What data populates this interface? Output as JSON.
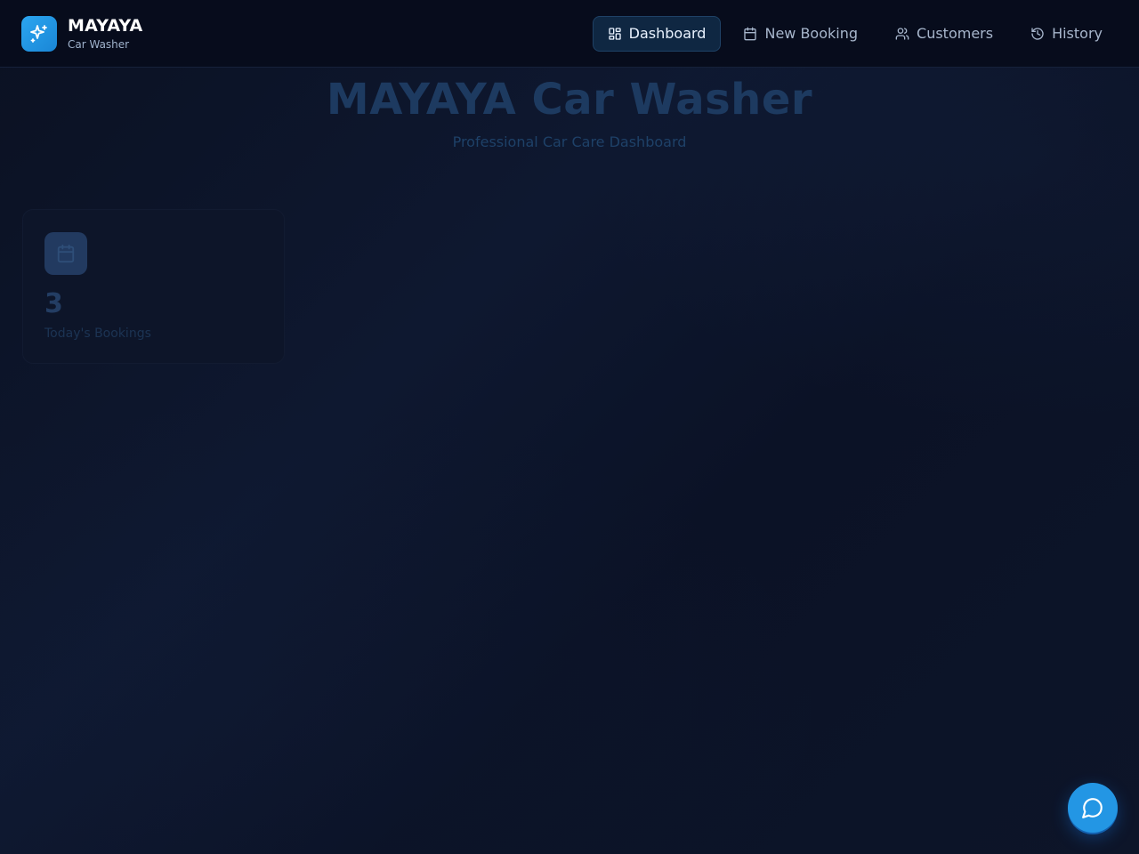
{
  "brand": {
    "name": "MAYAYA",
    "subtitle": "Car Washer",
    "logo_icon": "sparkles-icon",
    "accent_color": "#2ba6f0"
  },
  "nav": {
    "items": [
      {
        "label": "Dashboard",
        "icon": "grid-icon",
        "active": true
      },
      {
        "label": "New Booking",
        "icon": "calendar-icon",
        "active": false
      },
      {
        "label": "Customers",
        "icon": "users-icon",
        "active": false
      },
      {
        "label": "History",
        "icon": "history-icon",
        "active": false
      }
    ]
  },
  "hero": {
    "title": "MAYAYA Car Washer",
    "subtitle": "Professional Car Care Dashboard"
  },
  "stats": [
    {
      "value": "3",
      "label": "Today's Bookings",
      "icon": "calendar-icon"
    }
  ],
  "chat": {
    "icon": "message-circle-icon",
    "color": "#2396e4"
  }
}
